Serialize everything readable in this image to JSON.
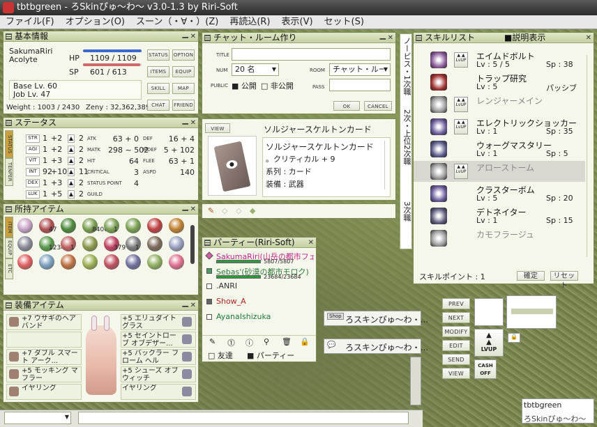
{
  "window": {
    "title": "tbtbgreen - ろSkinぴゅ～わ～ v3.0-1.3 by Riri-Soft"
  },
  "menu": [
    "ファイル(F)",
    "オプション(O)",
    "スーン（・∀・）(Z)",
    "再読込(R)",
    "表示(V)",
    "セット(S)"
  ],
  "basic": {
    "title": "基本情報",
    "name": "SakumaRiri",
    "job": "Acolyte",
    "hp_label": "HP",
    "hp": "1109 / 1109",
    "sp_label": "SP",
    "sp": "601 / 613",
    "base": "Base Lv. 60",
    "joblv": "Job Lv. 47",
    "weight": "Weight : 1003 / 2430",
    "zeny": "Zeny : 32,362,389",
    "hp_fraction": 1.0,
    "sp_fraction": 0.98,
    "buttons": [
      "STATUS",
      "OPTION",
      "ITEMS",
      "EQUIP",
      "SKILL",
      "MAP",
      "CHAT",
      "FRIEND"
    ]
  },
  "status": {
    "title": "ステータス",
    "tabs": [
      "STATUS",
      "TENPER"
    ],
    "stats": [
      {
        "name": "STR",
        "base": "1",
        "bonus": "+2",
        "cost": "2"
      },
      {
        "name": "AGI",
        "base": "1",
        "bonus": "+2",
        "cost": "2"
      },
      {
        "name": "VIT",
        "base": "1",
        "bonus": "+3",
        "cost": "2"
      },
      {
        "name": "INT",
        "base": "92",
        "bonus": "+10",
        "cost": "11"
      },
      {
        "name": "DEX",
        "base": "1",
        "bonus": "+3",
        "cost": "2"
      },
      {
        "name": "LUK",
        "base": "1",
        "bonus": "+5",
        "cost": "2"
      }
    ],
    "mid": [
      {
        "k": "ATK",
        "v": "63 + 0"
      },
      {
        "k": "MATK",
        "v": "298 ~ 502"
      },
      {
        "k": "HIT",
        "v": "64"
      },
      {
        "k": "CRITICAL",
        "v": "3"
      },
      {
        "k": "STATUS POINT",
        "v": "4"
      },
      {
        "k": "GUILD",
        "v": ""
      }
    ],
    "right": [
      {
        "k": "DEF",
        "v": "16 + 4"
      },
      {
        "k": "MDEF",
        "v": "5 + 102"
      },
      {
        "k": "FLEE",
        "v": "63 + 1"
      },
      {
        "k": "ASPD",
        "v": "140"
      }
    ]
  },
  "items": {
    "title": "所持アイテム",
    "tabs": [
      "ITEM",
      "EQUIP",
      "ETC"
    ],
    "counts": [
      "",
      "47",
      "",
      "8406",
      "1",
      "",
      "",
      "",
      "",
      "1234",
      "1",
      "",
      "379",
      "1",
      "",
      "",
      "",
      "",
      "",
      ""
    ],
    "icon_colors": [
      "#c9a3c8",
      "#b05050",
      "#4a8a3a",
      "#7aa050",
      "#7aa050",
      "#7aa050",
      "#c04040",
      "#c08030",
      "#8a8a9a",
      "#5a9a4a",
      "#c06060",
      "#8a9a4a",
      "#c04060",
      "#7a7a7a",
      "#7a6a5a",
      "#9aa0c0",
      "#e06060",
      "#7aa0c0",
      "#c07040",
      "#9ab050",
      "#c05060",
      "#7070a0",
      "#90b060",
      "#e07090"
    ]
  },
  "equip": {
    "title": "装備アイテム",
    "left": [
      "+7 ウサギのヘアバンド",
      "",
      "+7 ダブル スマート アーク...",
      "+5 モッキング マフラー",
      "イヤリング"
    ],
    "right": [
      "+5 エリュダイト グラス",
      "+5 セイントローブ オブデザー...",
      "+5 バックラー フローム ヘル",
      "+5 シューズ オブ ウィッチ",
      "イヤリング"
    ]
  },
  "chatroom": {
    "title": "チャット・ルーム作り",
    "title_label": "TITLE",
    "num_label": "NUM",
    "num_value": "20 名",
    "room_label": "ROOM",
    "room_value": "チャット・ルー",
    "public_label": "PUBLIC",
    "public_opt": "公開",
    "private_opt": "非公開",
    "pass_label": "PASS",
    "ok": "OK",
    "cancel": "CANCEL"
  },
  "card": {
    "view": "VIEW",
    "title": "ソルジャースケルトンカード",
    "name": "ソルジャースケルトンカード",
    "effect": "。クリティカル + 9",
    "series": "系列 : カード",
    "equip": "装備 : 武器"
  },
  "party": {
    "title": "パーティー(Riri-Soft)",
    "members": [
      {
        "name": "SakumaRiri(山岳の都市フェ",
        "hp": "5807/5807",
        "hp_fraction": 1.0,
        "color": "#c0208a"
      },
      {
        "name": "Sebas'(砂漠の都市モロク)",
        "hp": "23684/23684",
        "hp_fraction": 1.0,
        "color": "#2a7a3a"
      },
      {
        "name": ".ANRI",
        "hp": "",
        "hp_fraction": 0,
        "color": "#333"
      },
      {
        "name": "Show_A",
        "hp": "",
        "hp_fraction": 0,
        "color": "#b02020"
      },
      {
        "name": "AyanaIshizuka",
        "hp": "",
        "hp_fraction": 0,
        "color": "#1a7a3a"
      }
    ],
    "friend_tab": "友達",
    "party_tab": "パーティー"
  },
  "jobtabs": [
    "ノービス・1次職",
    "2次・上位2次職",
    "3次職"
  ],
  "skills": {
    "title": "スキルリスト",
    "desc_toggle": "説明表示",
    "list": [
      {
        "name": "エイムドボルト",
        "lv": "Lv : 5 / 5",
        "sp": "Sp : 38",
        "lvup": true,
        "color": "#8a5a9a",
        "grey": false
      },
      {
        "name": "トラップ研究",
        "lv": "Lv : 5",
        "sp": "パッシブ",
        "lvup": false,
        "color": "#a03030",
        "grey": false
      },
      {
        "name": "レンジャーメイン",
        "lv": "",
        "sp": "",
        "lvup": true,
        "color": "#9a9a9a",
        "grey": true
      },
      {
        "name": "エレクトリックショッカー",
        "lv": "Lv : 1",
        "sp": "Sp : 35",
        "lvup": true,
        "color": "#6a5a9a",
        "grey": false
      },
      {
        "name": "ウォーグマスタリー",
        "lv": "Lv : 1",
        "sp": "Sp : 5",
        "lvup": false,
        "color": "#5a5a8a",
        "grey": false
      },
      {
        "name": "アローストーム",
        "lv": "",
        "sp": "",
        "lvup": true,
        "color": "#9a9a9a",
        "grey": true
      },
      {
        "name": "クラスターボム",
        "lv": "Lv : 5",
        "sp": "Sp : 20",
        "lvup": false,
        "color": "#6a5a9a",
        "grey": false
      },
      {
        "name": "デトネイター",
        "lv": "Lv : 1",
        "sp": "Sp : 15",
        "lvup": false,
        "color": "#5a5a7a",
        "grey": false
      },
      {
        "name": "カモフラージュ",
        "lv": "",
        "sp": "",
        "lvup": false,
        "color": "#9a9a9a",
        "grey": true
      }
    ],
    "points": "スキルポイント : 1",
    "confirm": "確定",
    "reset": "リセット"
  },
  "shops": [
    {
      "label": "ろスキンぴゅ～わ・..."
    },
    {
      "label": "ろスキンぴゅ～わ・..."
    }
  ],
  "actions": [
    "PREV",
    "NEXT",
    "MODIFY",
    "EDIT",
    "SEND",
    "VIEW"
  ],
  "lvup_label": "LVUP",
  "cashoff": "CASH OFF",
  "namebox": {
    "line1": "tbtbgreen",
    "line2": "ろSkinぴゅ～わ～"
  }
}
